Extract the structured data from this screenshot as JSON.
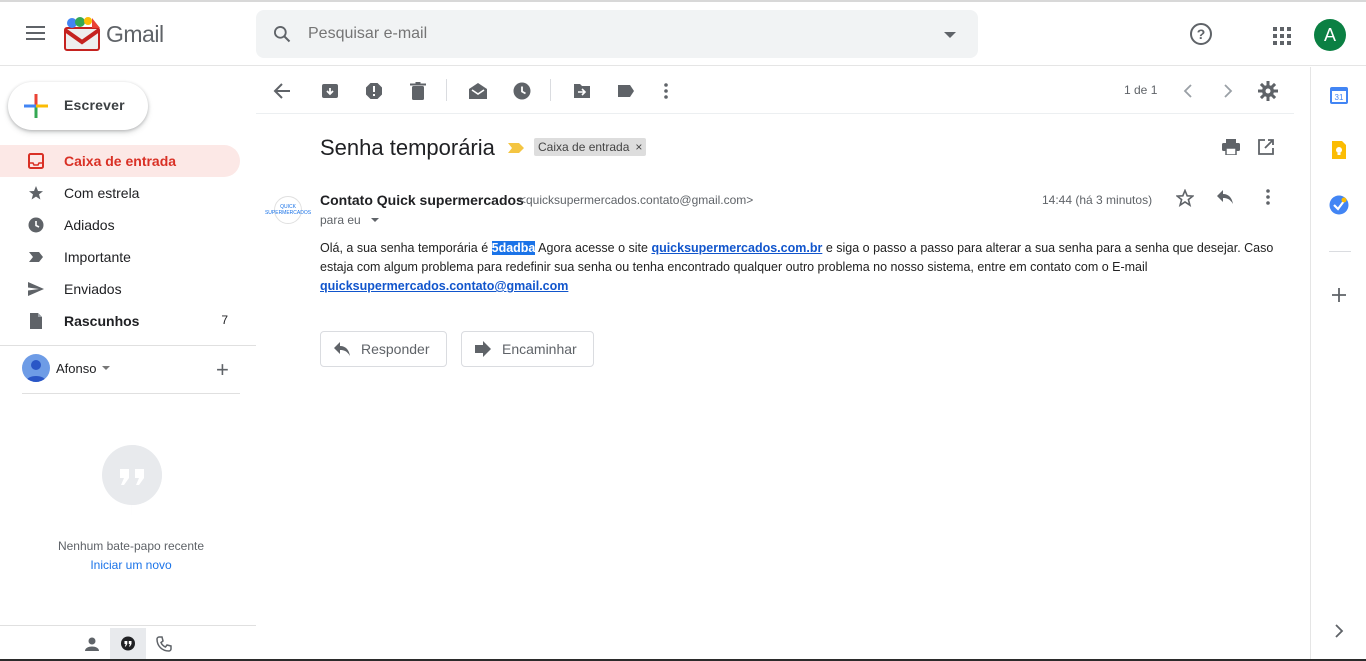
{
  "app": {
    "name": "Gmail"
  },
  "search": {
    "placeholder": "Pesquisar e-mail"
  },
  "account": {
    "initial": "A"
  },
  "compose": {
    "label": "Escrever"
  },
  "sidebar": {
    "items": [
      {
        "label": "Caixa de entrada",
        "icon": "inbox-icon",
        "active": true
      },
      {
        "label": "Com estrela",
        "icon": "star-icon"
      },
      {
        "label": "Adiados",
        "icon": "clock-icon"
      },
      {
        "label": "Importante",
        "icon": "label-important-icon"
      },
      {
        "label": "Enviados",
        "icon": "send-icon"
      },
      {
        "label": "Rascunhos",
        "icon": "draft-icon",
        "count": "7",
        "bold": true
      }
    ]
  },
  "hangouts": {
    "user": "Afonso",
    "empty_text": "Nenhum bate-papo recente",
    "start_link": "Iniciar um novo"
  },
  "toolbar": {
    "pager": "1 de 1"
  },
  "email": {
    "subject": "Senha temporária",
    "label_chip": "Caixa de entrada",
    "sender_name": "Contato Quick supermercados",
    "sender_email": "<quicksupermercados.contato@gmail.com>",
    "to": "para eu",
    "time": "14:44 (há 3 minutos)",
    "avatar_text": "QUICK SUPERMERCADOS",
    "body": {
      "p1": "Olá, a sua senha temporária é ",
      "password": "5dadba",
      "p2": " Agora acesse o site ",
      "site": "quicksupermercados.com.br",
      "p3": " e siga o passo a passo para alterar a sua senha para a senha que desejar. Caso estaja com algum problema para redefinir sua senha ou tenha encontrado qualquer outro problema no nosso sistema, entre em contato com o E-mail ",
      "email_link": "quicksupermercados.contato@gmail.com"
    },
    "reply_label": "Responder",
    "forward_label": "Encaminhar"
  },
  "colors": {
    "accent_red": "#d93025",
    "link_blue": "#1155cc",
    "avatar_green": "#0b8043"
  }
}
